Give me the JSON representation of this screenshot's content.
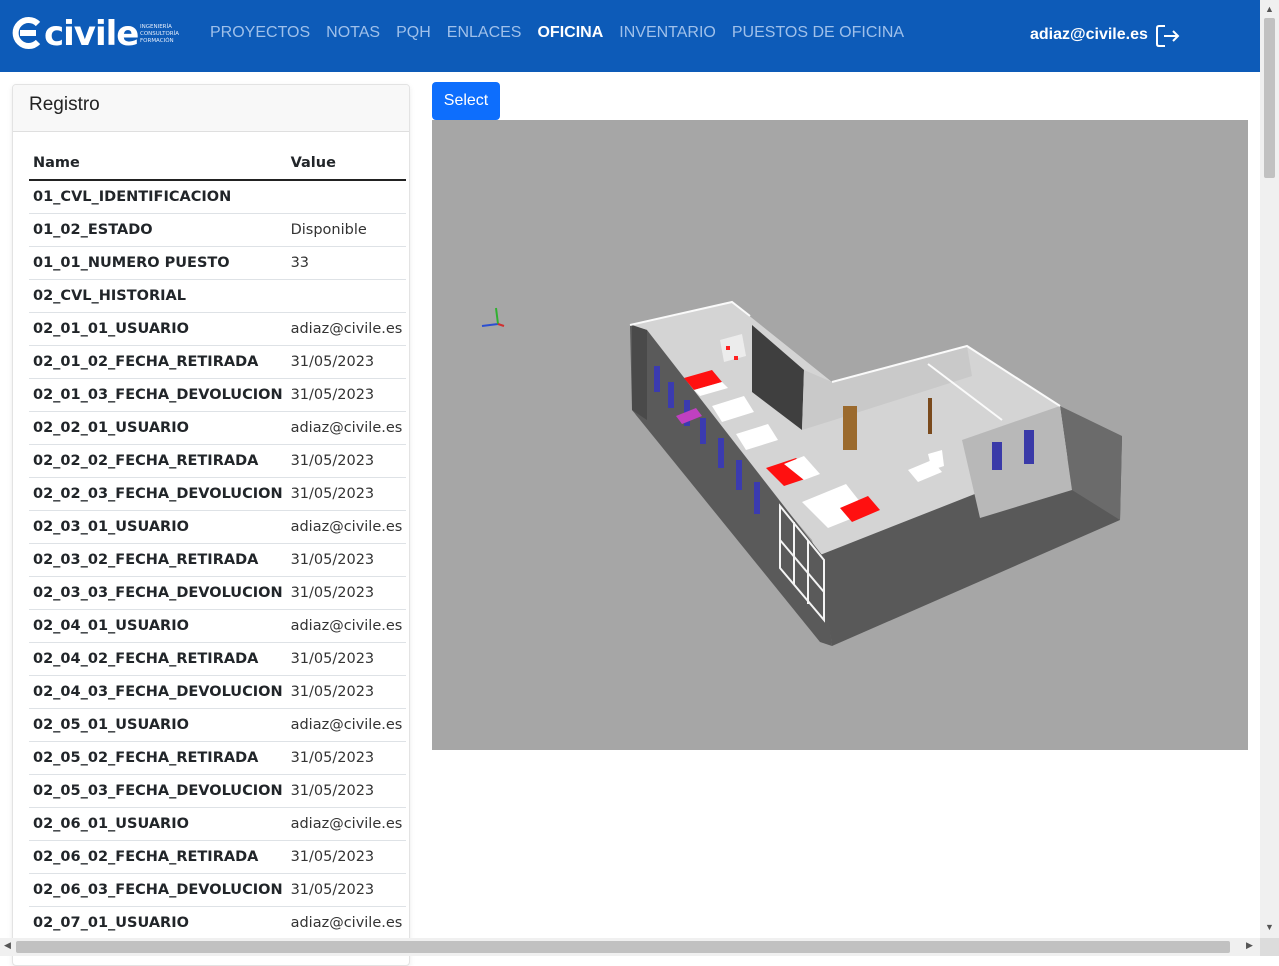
{
  "brand": {
    "name": "civile",
    "tagline": "INGENIERÍA CONSULTORÍA FORMACIÓN",
    "primary_color": "#0d5bb8"
  },
  "nav": {
    "items": [
      {
        "label": "PROYECTOS",
        "active": false
      },
      {
        "label": "NOTAS",
        "active": false
      },
      {
        "label": "PQH",
        "active": false
      },
      {
        "label": "ENLACES",
        "active": false
      },
      {
        "label": "OFICINA",
        "active": true
      },
      {
        "label": "INVENTARIO",
        "active": false
      },
      {
        "label": "PUESTOS DE OFICINA",
        "active": false
      }
    ],
    "user": "adiaz@civile.es",
    "logout_icon": "logout-icon"
  },
  "registro": {
    "title": "Registro",
    "col_name": "Name",
    "col_value": "Value",
    "rows": [
      {
        "name": "01_CVL_IDENTIFICACION",
        "value": ""
      },
      {
        "name": "01_02_ESTADO",
        "value": "Disponible"
      },
      {
        "name": "01_01_NUMERO PUESTO",
        "value": "33"
      },
      {
        "name": "02_CVL_HISTORIAL",
        "value": ""
      },
      {
        "name": "02_01_01_USUARIO",
        "value": "adiaz@civile.es"
      },
      {
        "name": "02_01_02_FECHA_RETIRADA",
        "value": "31/05/2023"
      },
      {
        "name": "02_01_03_FECHA_DEVOLUCION",
        "value": "31/05/2023"
      },
      {
        "name": "02_02_01_USUARIO",
        "value": "adiaz@civile.es"
      },
      {
        "name": "02_02_02_FECHA_RETIRADA",
        "value": "31/05/2023"
      },
      {
        "name": "02_02_03_FECHA_DEVOLUCION",
        "value": "31/05/2023"
      },
      {
        "name": "02_03_01_USUARIO",
        "value": "adiaz@civile.es"
      },
      {
        "name": "02_03_02_FECHA_RETIRADA",
        "value": "31/05/2023"
      },
      {
        "name": "02_03_03_FECHA_DEVOLUCION",
        "value": "31/05/2023"
      },
      {
        "name": "02_04_01_USUARIO",
        "value": "adiaz@civile.es"
      },
      {
        "name": "02_04_02_FECHA_RETIRADA",
        "value": "31/05/2023"
      },
      {
        "name": "02_04_03_FECHA_DEVOLUCION",
        "value": "31/05/2023"
      },
      {
        "name": "02_05_01_USUARIO",
        "value": "adiaz@civile.es"
      },
      {
        "name": "02_05_02_FECHA_RETIRADA",
        "value": "31/05/2023"
      },
      {
        "name": "02_05_03_FECHA_DEVOLUCION",
        "value": "31/05/2023"
      },
      {
        "name": "02_06_01_USUARIO",
        "value": "adiaz@civile.es"
      },
      {
        "name": "02_06_02_FECHA_RETIRADA",
        "value": "31/05/2023"
      },
      {
        "name": "02_06_03_FECHA_DEVOLUCION",
        "value": "31/05/2023"
      },
      {
        "name": "02_07_01_USUARIO",
        "value": "adiaz@civile.es"
      }
    ]
  },
  "viewer": {
    "select_label": "Select",
    "background": "#a6a6a6",
    "highlight_color": "#ff0000",
    "selected_color": "#c040c0"
  }
}
